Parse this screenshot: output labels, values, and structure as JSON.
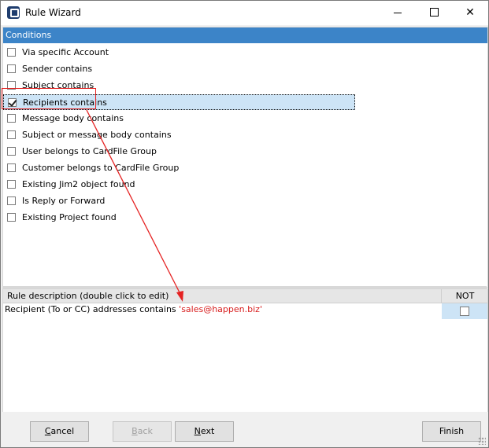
{
  "window": {
    "title": "Rule Wizard"
  },
  "conditions": {
    "header": "Conditions",
    "items": [
      {
        "label": "Via specific Account",
        "checked": false
      },
      {
        "label": "Sender contains",
        "checked": false
      },
      {
        "label": "Subject contains",
        "checked": false
      },
      {
        "label": "Recipients contains",
        "checked": true
      },
      {
        "label": "Message body contains",
        "checked": false
      },
      {
        "label": "Subject or message body contains",
        "checked": false
      },
      {
        "label": "User belongs to CardFile Group",
        "checked": false
      },
      {
        "label": "Customer belongs to CardFile Group",
        "checked": false
      },
      {
        "label": "Existing Jim2 object found",
        "checked": false
      },
      {
        "label": "Is Reply or Forward",
        "checked": false
      },
      {
        "label": "Existing Project found",
        "checked": false
      }
    ]
  },
  "rule": {
    "header": "Rule description (double click to edit)",
    "not_header": "NOT",
    "text": "Recipient (To or CC) addresses contains ",
    "quote_open": "'",
    "value": "sales@happen.biz",
    "quote_close": "'",
    "not_checked": false
  },
  "buttons": {
    "cancel": {
      "mnemonic": "C",
      "rest": "ancel"
    },
    "back": {
      "mnemonic": "B",
      "rest": "ack"
    },
    "next": {
      "mnemonic": "N",
      "rest": "ext"
    },
    "finish": {
      "label": "Finish"
    }
  },
  "colors": {
    "header_blue": "#3c84c8",
    "selection": "#cde4f6",
    "annotation_red": "#e52222"
  }
}
